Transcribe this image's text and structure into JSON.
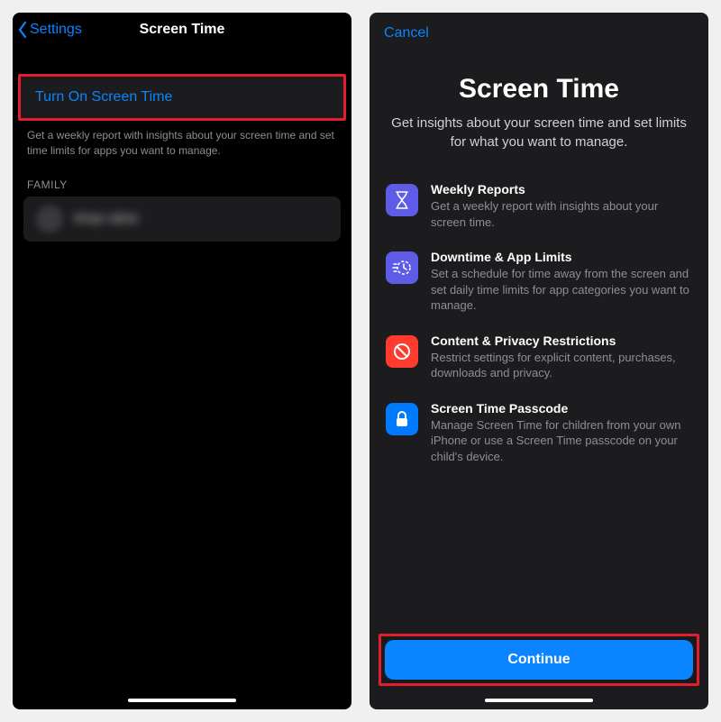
{
  "left": {
    "back_label": "Settings",
    "title": "Screen Time",
    "turn_on_label": "Turn On Screen Time",
    "description": "Get a weekly report with insights about your screen time and set time limits for apps you want to manage.",
    "family_header": "FAMILY",
    "family_member": "Khan Idrisi"
  },
  "right": {
    "cancel_label": "Cancel",
    "title": "Screen Time",
    "subtitle": "Get insights about your screen time and set limits for what you want to manage.",
    "features": [
      {
        "title": "Weekly Reports",
        "desc": "Get a weekly report with insights about your screen time."
      },
      {
        "title": "Downtime & App Limits",
        "desc": "Set a schedule for time away from the screen and set daily time limits for app categories you want to manage."
      },
      {
        "title": "Content & Privacy Restrictions",
        "desc": "Restrict settings for explicit content, purchases, downloads and privacy."
      },
      {
        "title": "Screen Time Passcode",
        "desc": "Manage Screen Time for children from your own iPhone or use a Screen Time passcode on your child's device."
      }
    ],
    "continue_label": "Continue"
  }
}
